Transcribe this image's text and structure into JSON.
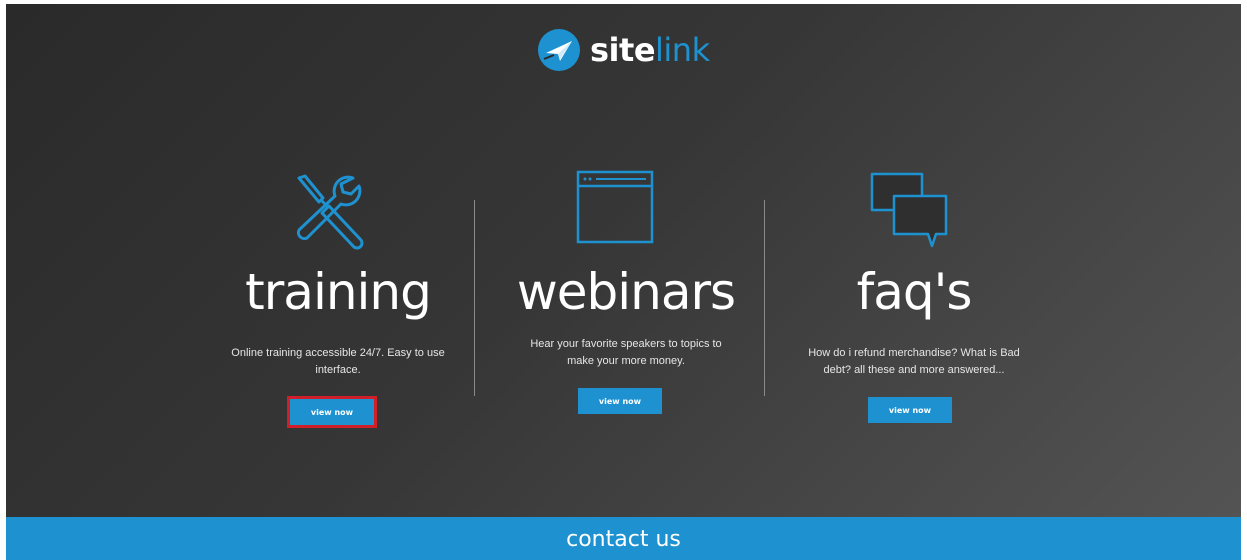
{
  "brand": {
    "name_bold": "site",
    "name_light": "link",
    "accent_color": "#1e92d0",
    "logo_icon": "paper-plane-logo-icon"
  },
  "sections": [
    {
      "icon": "tools-icon",
      "title": "training",
      "description": "Online training accessible 24/7. Easy to use interface.",
      "button_label": "view now",
      "button_highlighted": true
    },
    {
      "icon": "browser-window-icon",
      "title": "webinars",
      "description": "Hear your favorite speakers to topics to make your more money.",
      "button_label": "view now",
      "button_highlighted": false
    },
    {
      "icon": "chat-bubbles-icon",
      "title": "faq's",
      "description": "How do i refund merchandise? What is Bad debt? all these and more answered...",
      "button_label": "view now",
      "button_highlighted": false
    }
  ],
  "footer": {
    "contact_label": "contact us"
  },
  "colors": {
    "background": "#333333",
    "highlight_outline": "#d11f2a"
  }
}
